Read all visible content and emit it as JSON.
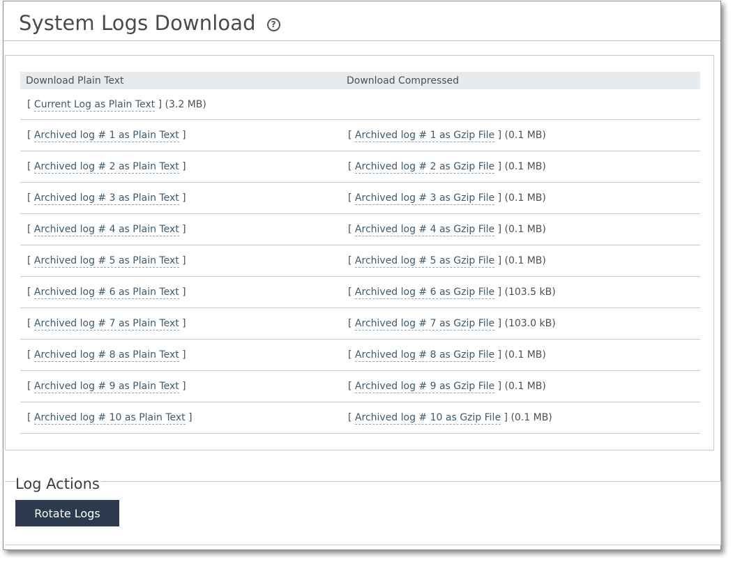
{
  "page": {
    "title": "System Logs Download",
    "help_icon": "question-circle-icon"
  },
  "table": {
    "headers": [
      "Download Plain Text",
      "Download Compressed"
    ],
    "current_row": {
      "link": "Current Log as Plain Text",
      "size": "(3.2 MB)"
    },
    "rows": [
      {
        "plain": "Archived log # 1 as Plain Text",
        "gzip": "Archived log # 1 as Gzip File",
        "size": "(0.1 MB)"
      },
      {
        "plain": "Archived log # 2 as Plain Text",
        "gzip": "Archived log # 2 as Gzip File",
        "size": "(0.1 MB)"
      },
      {
        "plain": "Archived log # 3 as Plain Text",
        "gzip": "Archived log # 3 as Gzip File",
        "size": "(0.1 MB)"
      },
      {
        "plain": "Archived log # 4 as Plain Text",
        "gzip": "Archived log # 4 as Gzip File",
        "size": "(0.1 MB)"
      },
      {
        "plain": "Archived log # 5 as Plain Text",
        "gzip": "Archived log # 5 as Gzip File",
        "size": "(0.1 MB)"
      },
      {
        "plain": "Archived log # 6 as Plain Text",
        "gzip": "Archived log # 6 as Gzip File",
        "size": "(103.5 kB)"
      },
      {
        "plain": "Archived log # 7 as Plain Text",
        "gzip": "Archived log # 7 as Gzip File",
        "size": "(103.0 kB)"
      },
      {
        "plain": "Archived log # 8 as Plain Text",
        "gzip": "Archived log # 8 as Gzip File",
        "size": "(0.1 MB)"
      },
      {
        "plain": "Archived log # 9 as Plain Text",
        "gzip": "Archived log # 9 as Gzip File",
        "size": "(0.1 MB)"
      },
      {
        "plain": "Archived log # 10 as Plain Text",
        "gzip": "Archived log # 10 as Gzip File",
        "size": "(0.1 MB)"
      }
    ]
  },
  "log_actions": {
    "legend": "Log Actions",
    "rotate_label": "Rotate Logs"
  },
  "colors": {
    "button_bg": "#2b3a4c",
    "header_bg": "#e8ebee",
    "link": "#3f5a6e"
  }
}
